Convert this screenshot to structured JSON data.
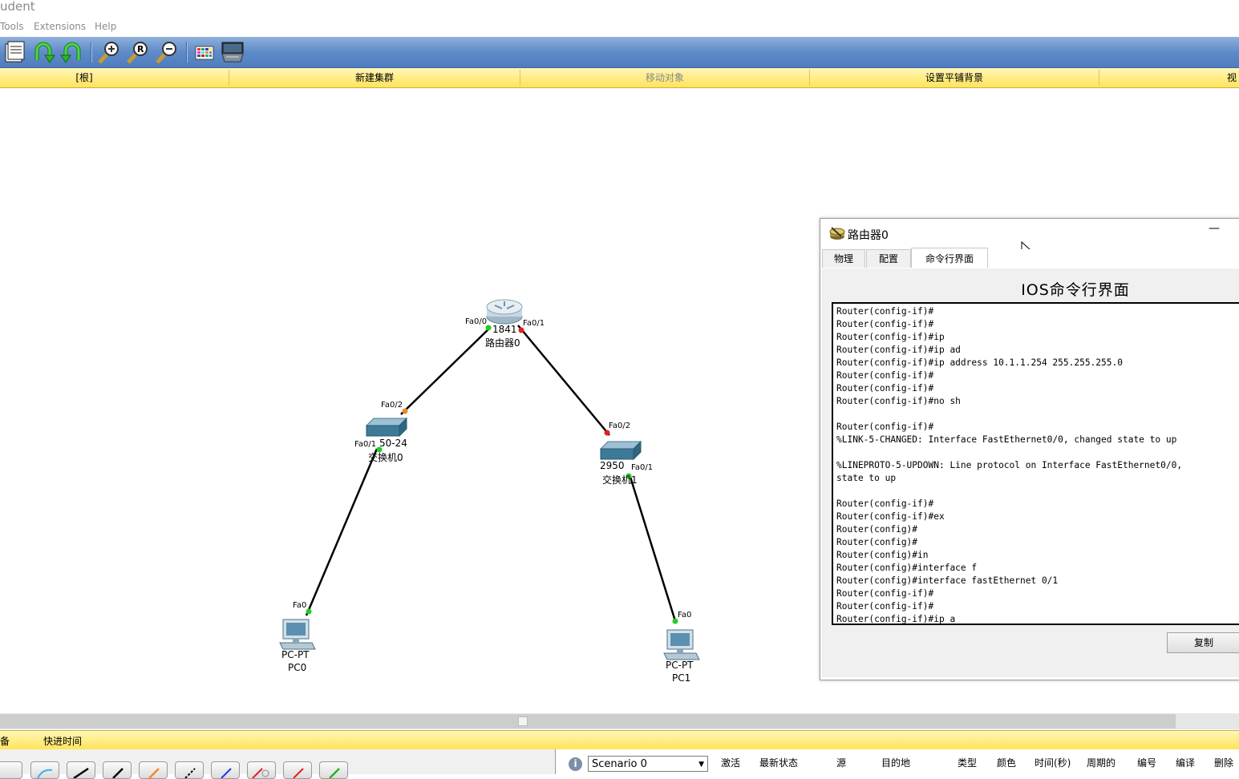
{
  "window": {
    "title": "udent"
  },
  "menu": {
    "items": [
      "Tools",
      "Extensions",
      "Help"
    ]
  },
  "toolbar": {
    "icons": [
      "activity-wizard-icon",
      "undo-icon",
      "redo-icon",
      "zoom-in-icon",
      "zoom-reset-icon",
      "zoom-out-icon",
      "palette-icon",
      "custom-device-icon"
    ]
  },
  "logic_bar": {
    "root": "[根]",
    "new_cluster": "新建集群",
    "move_object": "移动对象",
    "set_tiled_bg": "设置平铺背景",
    "edge": "视"
  },
  "topology": {
    "router": {
      "model": "1841",
      "name": "路由器0",
      "port_left": "Fa0/0",
      "port_right": "Fa0/1"
    },
    "switch0": {
      "model_suffix": "50-24",
      "name": "交换机0",
      "port_up": "Fa0/2",
      "port_down": "Fa0/1"
    },
    "switch1": {
      "model": "2950",
      "name": "交换机1",
      "port_up": "Fa0/2",
      "port_down": "Fa0/1"
    },
    "pc0": {
      "type": "PC-PT",
      "name": "PC0",
      "port": "Fa0"
    },
    "pc1": {
      "type": "PC-PT",
      "name": "PC1",
      "port": "Fa0"
    },
    "colors": {
      "link_up": "#22cc22",
      "link_down": "#e02020",
      "link_pending": "#f08a24"
    }
  },
  "dialog": {
    "title": "路由器0",
    "minimize": "—",
    "tabs": [
      "物理",
      "配置",
      "命令行界面"
    ],
    "active_tab": "命令行界面",
    "cli_heading": "IOS命令行界面",
    "console_lines": [
      "Router(config-if)#",
      "Router(config-if)#",
      "Router(config-if)#ip",
      "Router(config-if)#ip ad",
      "Router(config-if)#ip address 10.1.1.254 255.255.255.0",
      "Router(config-if)#",
      "Router(config-if)#",
      "Router(config-if)#no sh",
      "",
      "Router(config-if)#",
      "%LINK-5-CHANGED: Interface FastEthernet0/0, changed state to up",
      "",
      "%LINEPROTO-5-UPDOWN: Line protocol on Interface FastEthernet0/0,",
      "state to up",
      "",
      "Router(config-if)#",
      "Router(config-if)#ex",
      "Router(config)#",
      "Router(config)#",
      "Router(config)#in",
      "Router(config)#interface f",
      "Router(config)#interface fastEthernet 0/1",
      "Router(config-if)#",
      "Router(config-if)#",
      "Router(config-if)#ip a"
    ],
    "copy_button": "复制"
  },
  "realtime_bar": {
    "left_label": "备",
    "fast_forward": "快进时间"
  },
  "scenario": {
    "selected": "Scenario 0",
    "columns": [
      "激活",
      "最新状态",
      "源",
      "目的地",
      "类型",
      "颜色",
      "时间(秒)",
      "周期的",
      "编号",
      "编译",
      "删除"
    ]
  }
}
